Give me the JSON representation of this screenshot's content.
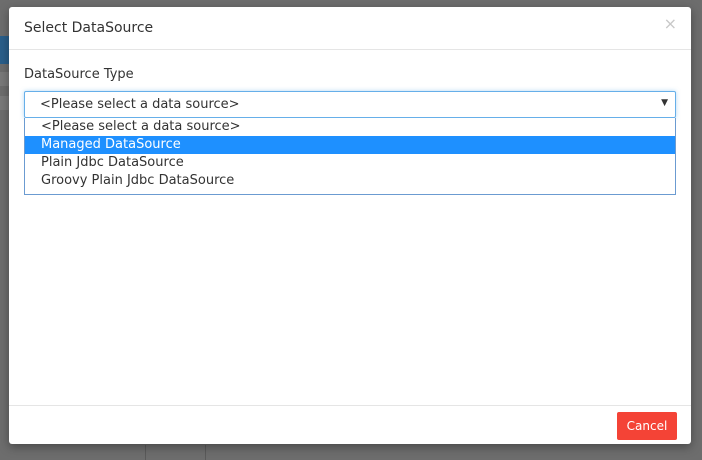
{
  "modal": {
    "title": "Select DataSource",
    "close_symbol": "×"
  },
  "form": {
    "label": "DataSource Type",
    "selected_value": "<Please select a data source>",
    "options": [
      "<Please select a data source>",
      "Managed DataSource",
      "Plain Jdbc DataSource",
      "Groovy Plain Jdbc DataSource"
    ],
    "highlighted_index": 1
  },
  "footer": {
    "cancel_label": "Cancel"
  },
  "icons": {
    "close": "close-icon",
    "dropdown": "caret-down-icon"
  },
  "colors": {
    "accent_blue": "#1e90ff",
    "cancel_red": "#f44336"
  }
}
